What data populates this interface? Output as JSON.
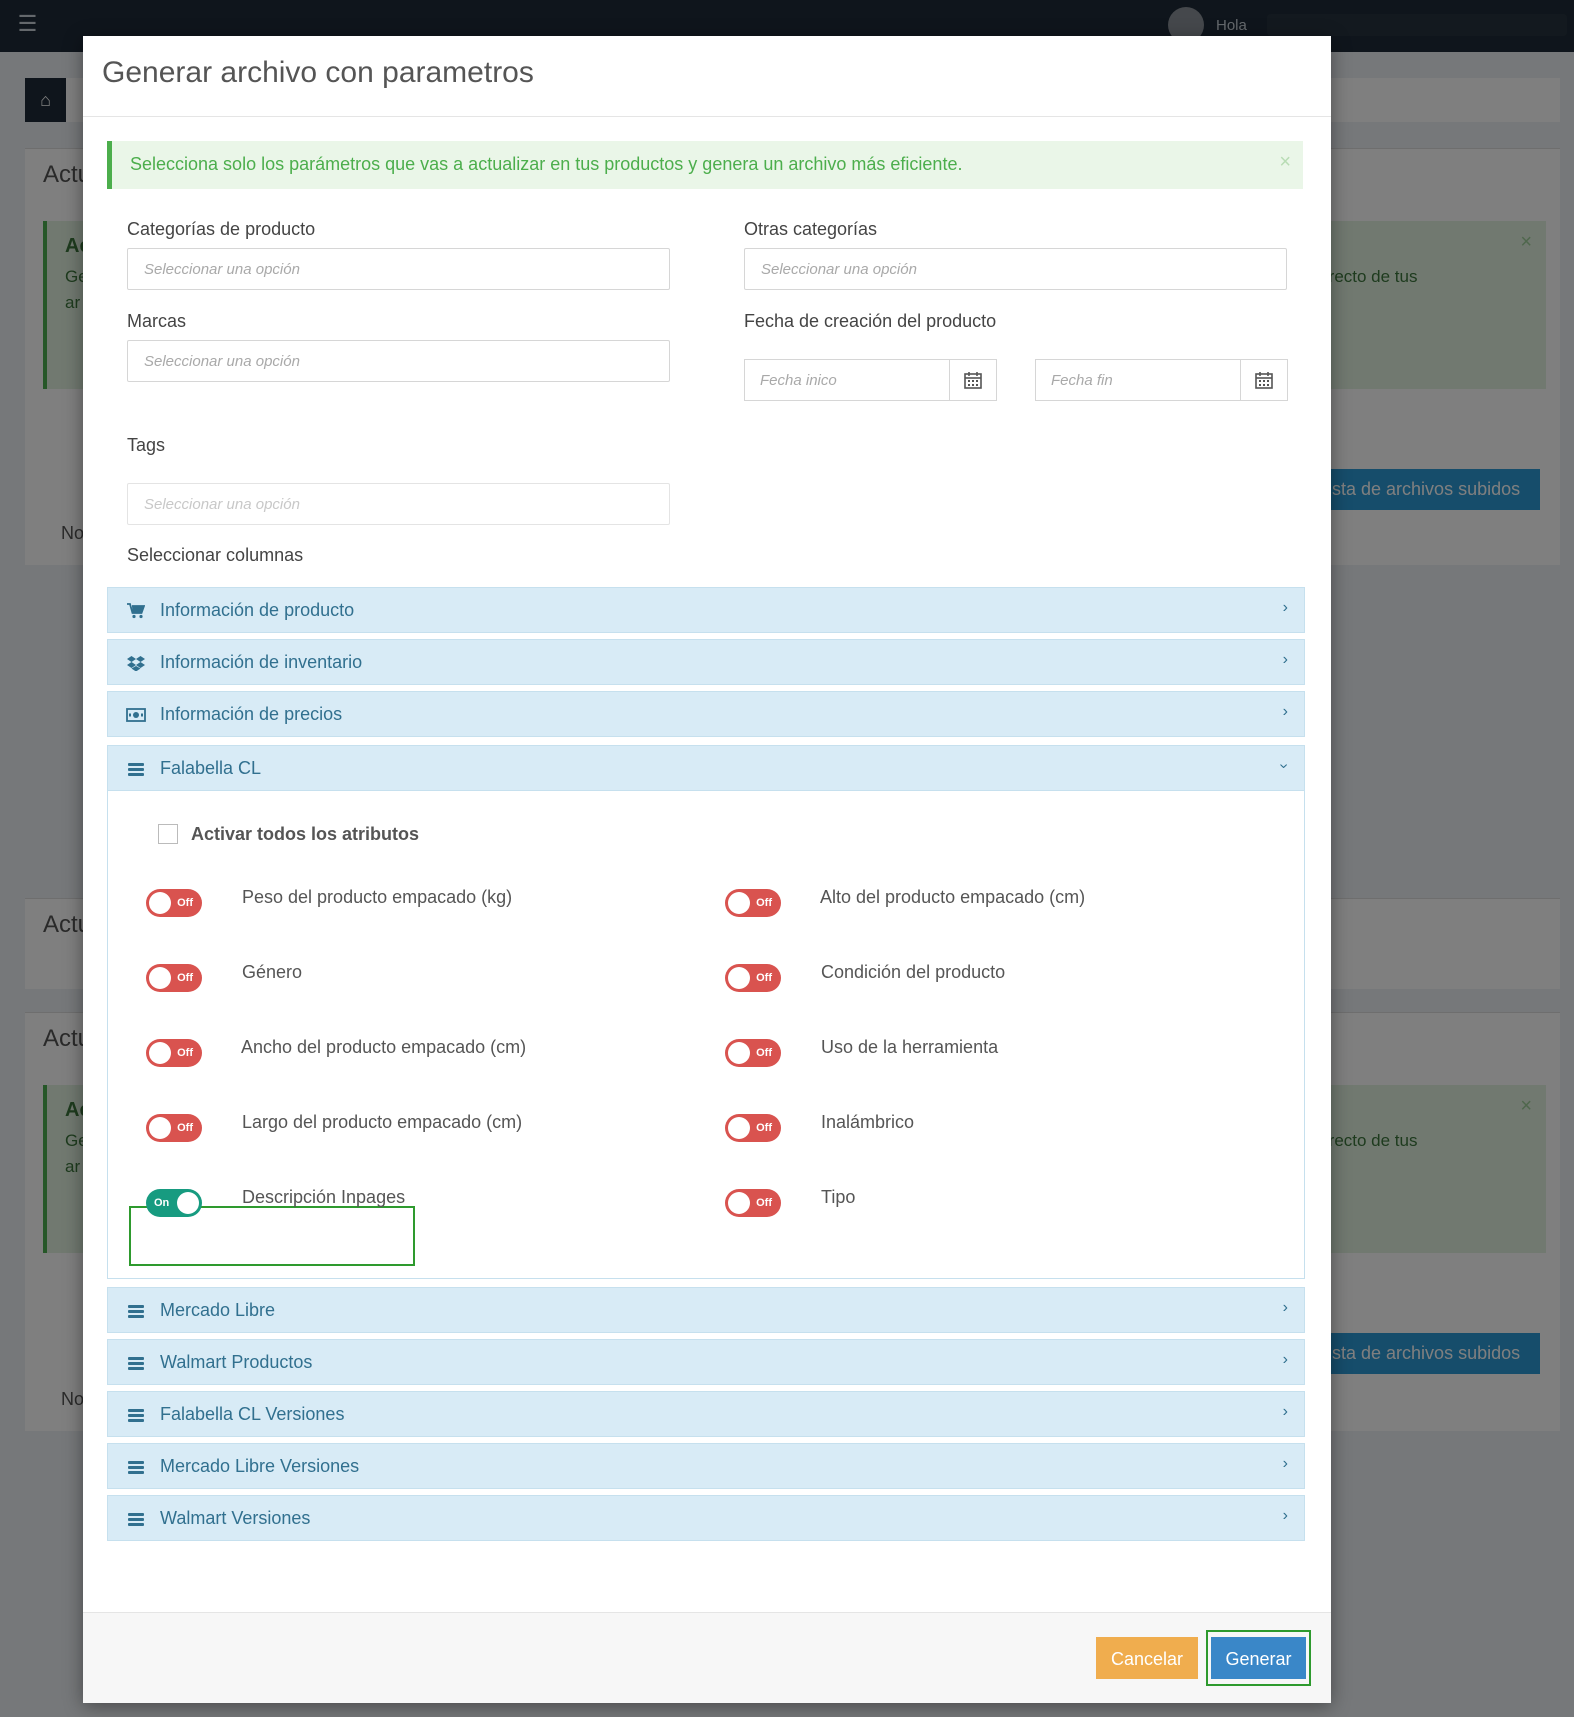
{
  "background": {
    "topbar": {
      "greeting": "Hola"
    },
    "panel_title": "Actu",
    "alert_text": "rrecto de tus",
    "alert_side_1": "Ac",
    "alert_side_2": "Ge",
    "alert_side_3": "ar",
    "list_button": "Lista de archivos subidos",
    "side_text": "No"
  },
  "modal": {
    "title": "Generar archivo con parametros",
    "alert": "Selecciona solo los parámetros que vas a actualizar en tus productos y genera un archivo más eficiente.",
    "close_symbol": "×",
    "fields": {
      "categorias_label": "Categorías de producto",
      "categorias_placeholder": "Seleccionar una opción",
      "otras_label": "Otras categorías",
      "otras_placeholder": "Seleccionar una opción",
      "marcas_label": "Marcas",
      "marcas_placeholder": "Seleccionar una opción",
      "fecha_label": "Fecha de creación del producto",
      "fecha_inicio_placeholder": "Fecha inico",
      "fecha_fin_placeholder": "Fecha fin",
      "tags_label": "Tags",
      "tags_placeholder": "Seleccionar una opción"
    },
    "columns_label": "Seleccionar columnas",
    "accordion": [
      {
        "label": "Información de producto",
        "icon": "cart-icon",
        "expanded": false
      },
      {
        "label": "Información de inventario",
        "icon": "dropbox-icon",
        "expanded": false
      },
      {
        "label": "Información de precios",
        "icon": "money-icon",
        "expanded": false
      },
      {
        "label": "Falabella CL",
        "icon": "bars-icon",
        "expanded": true
      },
      {
        "label": "Mercado Libre",
        "icon": "bars-icon",
        "expanded": false
      },
      {
        "label": "Walmart Productos",
        "icon": "bars-icon",
        "expanded": false
      },
      {
        "label": "Falabella CL Versiones",
        "icon": "bars-icon",
        "expanded": false
      },
      {
        "label": "Mercado Libre Versiones",
        "icon": "bars-icon",
        "expanded": false
      },
      {
        "label": "Walmart Versiones",
        "icon": "bars-icon",
        "expanded": false
      }
    ],
    "falabella": {
      "activate_all": "Activar todos los atributos",
      "switch_on_text": "On",
      "switch_off_text": "Off",
      "attributes": [
        {
          "label": "Peso del producto empacado (kg)",
          "on": false
        },
        {
          "label": "Alto del producto empacado (cm)",
          "on": false
        },
        {
          "label": "Género",
          "on": false
        },
        {
          "label": "Condición del producto",
          "on": false
        },
        {
          "label": "Ancho del producto empacado (cm)",
          "on": false
        },
        {
          "label": "Uso de la herramienta",
          "on": false
        },
        {
          "label": "Largo del producto empacado (cm)",
          "on": false
        },
        {
          "label": "Inalámbrico",
          "on": false
        },
        {
          "label": "Descripción Inpages",
          "on": true
        },
        {
          "label": "Tipo",
          "on": false
        }
      ]
    },
    "footer": {
      "cancel": "Cancelar",
      "generate": "Generar"
    }
  }
}
